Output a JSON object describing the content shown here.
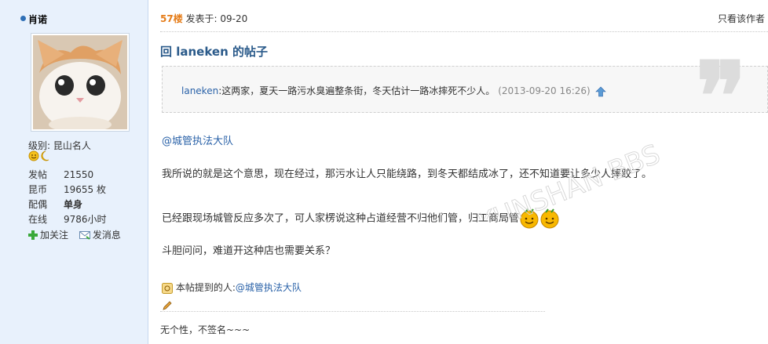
{
  "user": {
    "name": "肖诺",
    "level_label": "级别:",
    "level_value": "昆山名人",
    "stats": [
      {
        "key": "发帖",
        "value": "21550"
      },
      {
        "key": "昆币",
        "value": "19655 枚"
      },
      {
        "key": "配偶",
        "value": "单身"
      },
      {
        "key": "在线",
        "value": "9786小时"
      }
    ],
    "actions": {
      "follow": "加关注",
      "message": "发消息"
    }
  },
  "post": {
    "floor": "57楼",
    "posted_label": "发表于: 09-20",
    "only_author": "只看该作者",
    "title": "回 laneken 的帖子",
    "quote": {
      "author": "laneken",
      "text": ":这两家，夏天一路污水臭遍整条街，冬天估计一路冰摔死不少人。",
      "time": "(2013-09-20 16:26)"
    },
    "mention": "@城管执法大队",
    "paragraphs": [
      "我所说的就是这个意思，现在经过，那污水让人只能绕路，到冬天都结成冰了，还不知道要让多少人摔跤了。",
      "已经跟现场城管反应多次了，可人家楞说这种占道经营不归他们管，归工商局管",
      "斗胆问问，难道开这种店也需要关系？"
    ],
    "mentioned_label": "本帖提到的人:",
    "mentioned_user": "@城管执法大队",
    "signature": "无个性，不签名~~~"
  },
  "watermark": "KUNSHAN BBS",
  "colors": {
    "sidebar_bg": "#e8f1fc",
    "link": "#2a62a8",
    "floor": "#e57d1a",
    "title": "#2a5a8a"
  }
}
